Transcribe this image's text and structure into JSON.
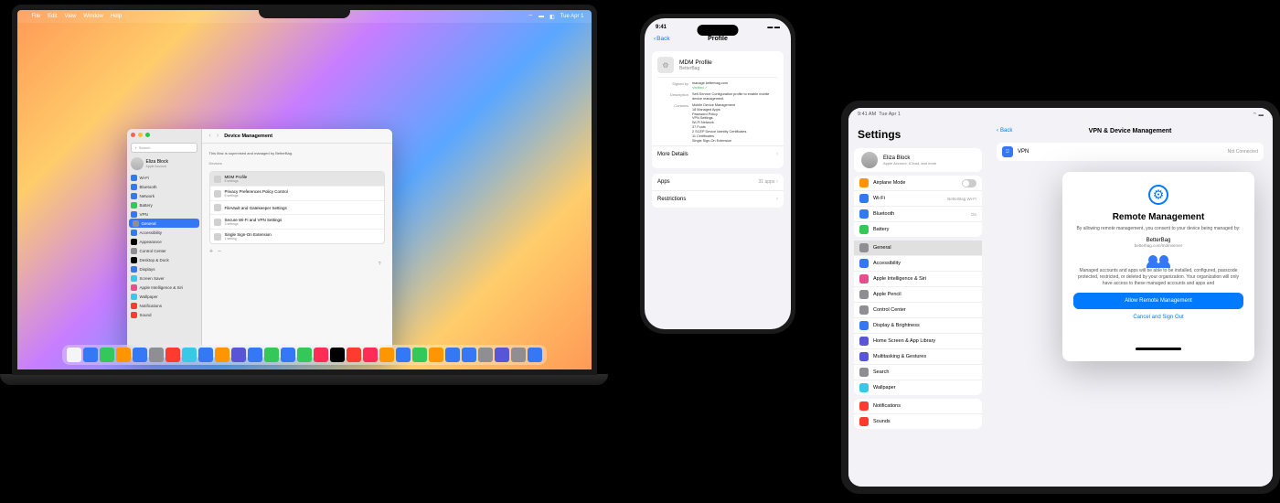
{
  "mac": {
    "menubar": {
      "items": [
        "File",
        "Edit",
        "View",
        "Window",
        "Help"
      ],
      "date": "Tue Apr 1"
    },
    "settings": {
      "search_placeholder": "Search",
      "account": {
        "name": "Eliza Block",
        "sub": "Apple Account"
      },
      "sidebar": [
        {
          "label": "Wi-Fi",
          "color": "#3478f6"
        },
        {
          "label": "Bluetooth",
          "color": "#3478f6"
        },
        {
          "label": "Network",
          "color": "#3478f6"
        },
        {
          "label": "Battery",
          "color": "#34c759"
        },
        {
          "label": "VPN",
          "color": "#3478f6"
        },
        {
          "label": "General",
          "color": "#8e8e93",
          "selected": true
        },
        {
          "label": "Accessibility",
          "color": "#3478f6"
        },
        {
          "label": "Appearance",
          "color": "#000"
        },
        {
          "label": "Control Center",
          "color": "#8e8e93"
        },
        {
          "label": "Desktop & Dock",
          "color": "#000"
        },
        {
          "label": "Displays",
          "color": "#3478f6"
        },
        {
          "label": "Screen Saver",
          "color": "#3ac8e8"
        },
        {
          "label": "Apple Intelligence & Siri",
          "color": "#eb4d8c"
        },
        {
          "label": "Wallpaper",
          "color": "#3ac8e8"
        },
        {
          "label": "Notifications",
          "color": "#ff3b30"
        },
        {
          "label": "Sound",
          "color": "#ff3b30"
        }
      ],
      "main": {
        "title": "Device Management",
        "notice": "This Mac is supervised and managed by BetterBag.",
        "devices_label": "Devices",
        "rows": [
          {
            "label": "MDM Profile",
            "sub": "5 settings",
            "selected": true
          },
          {
            "label": "Privacy Preferences Policy Control",
            "sub": "8 settings"
          },
          {
            "label": "FileVault and Gatekeeper Settings",
            "sub": ""
          },
          {
            "label": "Secure Wi-Fi and VPN Settings",
            "sub": "3 settings"
          },
          {
            "label": "Single Sign-On Extension",
            "sub": "1 setting"
          }
        ]
      }
    },
    "dock_colors": [
      "#f5f5f7",
      "#3478f6",
      "#34c759",
      "#ff9500",
      "#3478f6",
      "#8e8e93",
      "#ff3b30",
      "#3ac8e8",
      "#3478f6",
      "#ff9500",
      "#5856d6",
      "#3478f6",
      "#34c759",
      "#3478f6",
      "#34c759",
      "#ff2d55",
      "#000",
      "#ff3b30",
      "#ff2d55",
      "#ff9500",
      "#3478f6",
      "#34c759",
      "#ff9500",
      "#3478f6",
      "#3478f6",
      "#8e8e93",
      "#5856d6",
      "#8e8e93",
      "#3478f6"
    ]
  },
  "iphone": {
    "time": "9:41",
    "back": "Back",
    "title": "Profile",
    "profile": {
      "name": "MDM Profile",
      "org": "BetterBag",
      "signed_by_label": "Signed by",
      "signed_by": "manage.betterbag.com",
      "verified": "Verified ✓",
      "desc_label": "Description",
      "desc": "Self-Service Configuration profile to enable mobile device management.",
      "contains_label": "Contains",
      "contains": "Mobile Device Management\n18 Managed Apps\nPassword Policy\nVPN Settings\nWi-Fi Network\n37 Fonts\n2 SCEP Device Identity Certificates\n11 Certificates\nSingle Sign-On Extension"
    },
    "more_details": "More Details",
    "apps": {
      "label": "Apps",
      "count": "31 apps"
    },
    "restrictions": "Restrictions"
  },
  "ipad": {
    "status": {
      "time": "9:41 AM",
      "date": "Tue Apr 1"
    },
    "sidebar_title": "Settings",
    "account": {
      "name": "Eliza Block",
      "sub": "Apple Account, iCloud, and more"
    },
    "group1": [
      {
        "label": "Airplane Mode",
        "color": "#ff9500",
        "toggle": true
      },
      {
        "label": "Wi-Fi",
        "color": "#3478f6",
        "val": "BetterBag Wi-Fi"
      },
      {
        "label": "Bluetooth",
        "color": "#3478f6",
        "val": "On"
      },
      {
        "label": "Battery",
        "color": "#34c759"
      }
    ],
    "group2": [
      {
        "label": "General",
        "color": "#8e8e93",
        "selected": true
      },
      {
        "label": "Accessibility",
        "color": "#3478f6"
      },
      {
        "label": "Apple Intelligence & Siri",
        "color": "#eb4d8c"
      },
      {
        "label": "Apple Pencil",
        "color": "#8e8e93"
      },
      {
        "label": "Control Center",
        "color": "#8e8e93"
      },
      {
        "label": "Display & Brightness",
        "color": "#3478f6"
      },
      {
        "label": "Home Screen & App Library",
        "color": "#5856d6"
      },
      {
        "label": "Multitasking & Gestures",
        "color": "#5856d6"
      },
      {
        "label": "Search",
        "color": "#8e8e93"
      },
      {
        "label": "Wallpaper",
        "color": "#3ac8e8"
      }
    ],
    "group3": [
      {
        "label": "Notifications",
        "color": "#ff3b30"
      },
      {
        "label": "Sounds",
        "color": "#ff3b30"
      }
    ],
    "main": {
      "back": "Back",
      "title": "VPN & Device Management",
      "vpn": {
        "label": "VPN",
        "status": "Not Connected"
      }
    },
    "modal": {
      "title": "Remote Management",
      "consent": "By allowing remote management, you consent to your device being managed by:",
      "org": "BetterBag",
      "url": "betterbag.com/mdmserver",
      "detail": "Managed accounts and apps will be able to be installed, configured, passcode protected, restricted, or deleted by your organization. Your organization will only have access to these managed accounts and apps and",
      "allow": "Allow Remote Management",
      "cancel": "Cancel and Sign Out"
    }
  }
}
